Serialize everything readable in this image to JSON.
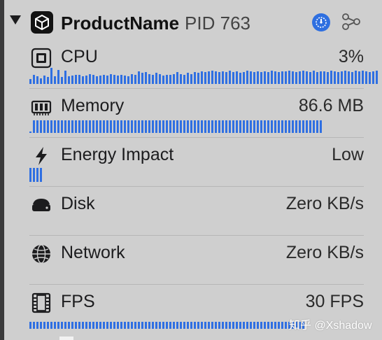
{
  "colors": {
    "accent": "#2f6fe2",
    "background": "#cfcfcf"
  },
  "process": {
    "name": "ProductName",
    "pid": "PID 763",
    "icon": "unity-logo-icon",
    "gauge_icon": "gauge-icon",
    "graph_icon": "share-graph-icon"
  },
  "metrics": [
    {
      "id": "cpu",
      "label": "CPU",
      "value": "3%",
      "icon": "cpu-chip-icon",
      "bars": [
        0.3,
        0.55,
        0.45,
        0.35,
        0.5,
        0.4,
        0.95,
        0.45,
        0.85,
        0.4,
        0.8,
        0.45,
        0.5,
        0.55,
        0.55,
        0.45,
        0.5,
        0.6,
        0.55,
        0.45,
        0.5,
        0.55,
        0.5,
        0.6,
        0.55,
        0.5,
        0.55,
        0.5,
        0.45,
        0.6,
        0.55,
        0.75,
        0.65,
        0.7,
        0.6,
        0.55,
        0.65,
        0.6,
        0.5,
        0.55,
        0.55,
        0.6,
        0.7,
        0.6,
        0.55,
        0.65,
        0.6,
        0.7,
        0.65,
        0.75,
        0.7,
        0.75,
        0.8,
        0.75,
        0.7,
        0.75,
        0.7,
        0.8,
        0.7,
        0.75,
        0.65,
        0.7,
        0.8,
        0.75,
        0.7,
        0.75,
        0.7,
        0.75,
        0.7,
        0.8,
        0.75,
        0.7,
        0.75,
        0.75,
        0.8,
        0.75,
        0.7,
        0.75,
        0.8,
        0.75,
        0.7,
        0.8,
        0.7,
        0.75,
        0.75,
        0.7,
        0.8,
        0.75,
        0.7,
        0.75,
        0.8,
        0.75,
        0.7,
        0.8,
        0.75,
        0.8,
        0.75,
        0.7,
        0.75,
        0.8
      ]
    },
    {
      "id": "memory",
      "label": "Memory",
      "value": "86.6 MB",
      "icon": "memory-chip-icon",
      "bars": [
        0.1,
        0.75,
        0.75,
        0.75,
        0.75,
        0.75,
        0.75,
        0.75,
        0.75,
        0.75,
        0.75,
        0.75,
        0.75,
        0.75,
        0.75,
        0.75,
        0.75,
        0.75,
        0.75,
        0.75,
        0.75,
        0.75,
        0.75,
        0.75,
        0.75,
        0.75,
        0.75,
        0.75,
        0.75,
        0.75,
        0.75,
        0.75,
        0.75,
        0.75,
        0.75,
        0.75,
        0.75,
        0.75,
        0.75,
        0.75,
        0.75,
        0.75,
        0.75,
        0.75,
        0.75,
        0.75,
        0.75,
        0.75,
        0.75,
        0.75,
        0.75,
        0.75,
        0.75,
        0.75,
        0.75,
        0.75,
        0.75,
        0.75,
        0.75,
        0.75,
        0.75,
        0.75,
        0.75,
        0.75,
        0.75,
        0.75,
        0.75,
        0.75,
        0.75,
        0.75,
        0.75,
        0.75,
        0.75,
        0.75,
        0.75,
        0.75,
        0.75,
        0.75,
        0.75,
        0.75,
        0.75,
        0.75,
        0.75,
        0.75
      ]
    },
    {
      "id": "energy",
      "label": "Energy Impact",
      "value": "Low",
      "icon": "lightning-bolt-icon",
      "bars": [
        0.85,
        0.85,
        0.85,
        0.85
      ]
    },
    {
      "id": "disk",
      "label": "Disk",
      "value": "Zero KB/s",
      "icon": "hard-drive-icon",
      "bars": []
    },
    {
      "id": "network",
      "label": "Network",
      "value": "Zero KB/s",
      "icon": "globe-network-icon",
      "bars": []
    },
    {
      "id": "fps",
      "label": "FPS",
      "value": "30 FPS",
      "icon": "film-strip-icon",
      "bars": [
        0.4,
        0.4,
        0.4,
        0.4,
        0.4,
        0.4,
        0.4,
        0.4,
        0.4,
        0.4,
        0.4,
        0.4,
        0.4,
        0.4,
        0.4,
        0.4,
        0.4,
        0.4,
        0.4,
        0.4,
        0.4,
        0.4,
        0.4,
        0.4,
        0.4,
        0.4,
        0.4,
        0.4,
        0.4,
        0.4,
        0.4,
        0.4,
        0.4,
        0.4,
        0.4,
        0.4,
        0.4,
        0.4,
        0.4,
        0.4,
        0.4,
        0.4,
        0.4,
        0.4,
        0.4,
        0.4,
        0.4,
        0.4,
        0.4,
        0.4,
        0.4,
        0.4,
        0.4,
        0.4,
        0.4,
        0.4,
        0.4,
        0.4,
        0.4,
        0.4,
        0.4,
        0.4,
        0.4,
        0.4,
        0.4,
        0.4,
        0.4,
        0.4,
        0.4,
        0.4,
        0.4,
        0.4,
        0.4,
        0.4,
        0.4,
        0.4,
        0.4,
        0.4,
        0.4
      ]
    }
  ],
  "watermark": "知乎 @Xshadow"
}
